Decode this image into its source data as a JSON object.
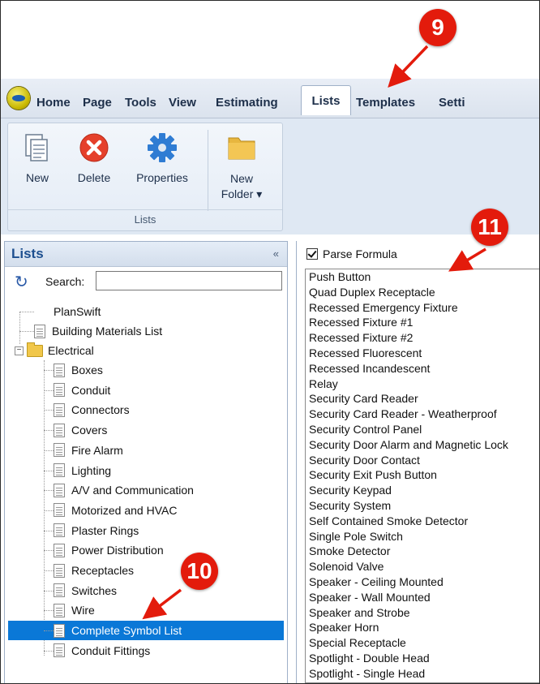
{
  "tabs": [
    "Home",
    "Page",
    "Tools",
    "View",
    "Estimating",
    "Lists",
    "Templates",
    "Setti"
  ],
  "active_tab": "Lists",
  "ribbon": {
    "buttons": {
      "new": "New",
      "delete": "Delete",
      "properties": "Properties",
      "new_folder_line1": "New",
      "new_folder_line2": "Folder ▾"
    },
    "group_label": "Lists"
  },
  "lists_panel": {
    "title": "Lists",
    "collapse": "«",
    "search_label": "Search:",
    "search_value": ""
  },
  "tree": {
    "planswift": "PlanSwift",
    "building_materials": "Building Materials List",
    "electrical": "Electrical",
    "children": [
      "Boxes",
      "Conduit",
      "Connectors",
      "Covers",
      "Fire Alarm",
      "Lighting",
      "A/V and Communication",
      "Motorized and HVAC",
      "Plaster Rings",
      "Power Distribution",
      "Receptacles",
      "Switches",
      "Wire",
      "Complete Symbol List",
      "Conduit Fittings"
    ],
    "selected": "Complete Symbol List"
  },
  "right_panel": {
    "parse_formula_label": "Parse Formula",
    "parse_formula_checked": true,
    "symbols": [
      "Push Button",
      "Quad Duplex Receptacle",
      "Recessed Emergency Fixture",
      "Recessed Fixture #1",
      "Recessed Fixture #2",
      "Recessed Fluorescent",
      "Recessed Incandescent",
      "Relay",
      "Security Card Reader",
      "Security Card Reader - Weatherproof",
      "Security Control Panel",
      "Security Door Alarm and Magnetic Lock",
      "Security Door Contact",
      "Security Exit Push Button",
      "Security Keypad",
      "Security System",
      "Self Contained Smoke Detector",
      "Single Pole Switch",
      "Smoke Detector",
      "Solenoid Valve",
      "Speaker - Ceiling Mounted",
      "Speaker - Wall Mounted",
      "Speaker and Strobe",
      "Speaker Horn",
      "Special Receptacle",
      "Spotlight - Double Head",
      "Spotlight - Single Head"
    ]
  },
  "callouts": [
    "9",
    "10",
    "11"
  ],
  "colors": {
    "callout": "#e31b0c",
    "selection": "#0a78d7",
    "accent_text": "#1d4f8f"
  },
  "icons": {
    "new": "new-document-icon",
    "delete": "delete-x-icon",
    "properties": "gear-icon",
    "new_folder": "folder-icon",
    "refresh": "refresh-icon"
  }
}
